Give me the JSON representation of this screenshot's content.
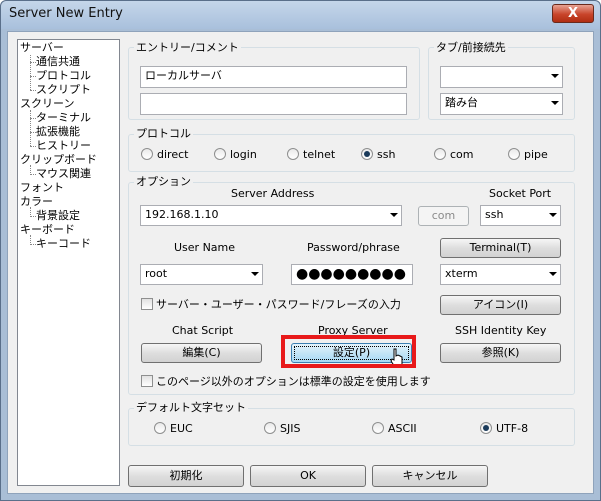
{
  "window": {
    "title": "Server New Entry",
    "close_label": "X"
  },
  "tree": {
    "items": [
      {
        "label": "サーバー",
        "level": 0
      },
      {
        "label": "通信共通",
        "level": 1
      },
      {
        "label": "プロトコル",
        "level": 1
      },
      {
        "label": "スクリプト",
        "level": 1
      },
      {
        "label": "スクリーン",
        "level": 0
      },
      {
        "label": "ターミナル",
        "level": 1
      },
      {
        "label": "拡張機能",
        "level": 1
      },
      {
        "label": "ヒストリー",
        "level": 1
      },
      {
        "label": "クリップボード",
        "level": 0
      },
      {
        "label": "マウス関連",
        "level": 1
      },
      {
        "label": "フォント",
        "level": 0
      },
      {
        "label": "カラー",
        "level": 0
      },
      {
        "label": "背景設定",
        "level": 1
      },
      {
        "label": "キーボード",
        "level": 0
      },
      {
        "label": "キーコード",
        "level": 1
      }
    ]
  },
  "entry": {
    "group_label": "エントリー/コメント",
    "entry_value": "ローカルサーバ",
    "comment_value": ""
  },
  "tab": {
    "group_label": "タブ/前接続先",
    "tab_value": "",
    "prev_value": "踏み台"
  },
  "protocol": {
    "group_label": "プロトコル",
    "options": [
      {
        "label": "direct",
        "selected": false
      },
      {
        "label": "login",
        "selected": false
      },
      {
        "label": "telnet",
        "selected": false
      },
      {
        "label": "ssh",
        "selected": true
      },
      {
        "label": "com",
        "selected": false
      },
      {
        "label": "pipe",
        "selected": false
      }
    ]
  },
  "options": {
    "group_label": "オプション",
    "server_address_label": "Server Address",
    "server_address_value": "192.168.1.10",
    "com_button": "com",
    "socket_port_label": "Socket Port",
    "socket_port_value": "ssh",
    "user_name_label": "User Name",
    "user_name_value": "root",
    "password_label": "Password/phrase",
    "password_value": "●●●●●●●●●",
    "terminal_button": "Terminal(T)",
    "terminal_value": "xterm",
    "save_input_label": "サーバー・ユーザー・パスワード/フレーズの入力",
    "icon_button": "アイコン(I)",
    "chat_script_label": "Chat Script",
    "chat_edit_button": "編集(C)",
    "proxy_server_label": "Proxy Server",
    "proxy_setting_button": "設定(P)",
    "ssh_identity_label": "SSH Identity Key",
    "ssh_browse_button": "参照(K)",
    "standard_options_label": "このページ以外のオプションは標準の設定を使用します"
  },
  "charset": {
    "group_label": "デフォルト文字セット",
    "options": [
      {
        "label": "EUC",
        "selected": false
      },
      {
        "label": "SJIS",
        "selected": false
      },
      {
        "label": "ASCII",
        "selected": false
      },
      {
        "label": "UTF-8",
        "selected": true
      }
    ]
  },
  "footer": {
    "init_button": "初期化",
    "ok_button": "OK",
    "cancel_button": "キャンセル"
  },
  "colors": {
    "highlight": "#e8191a",
    "titlebar": "#a9c0dc"
  }
}
